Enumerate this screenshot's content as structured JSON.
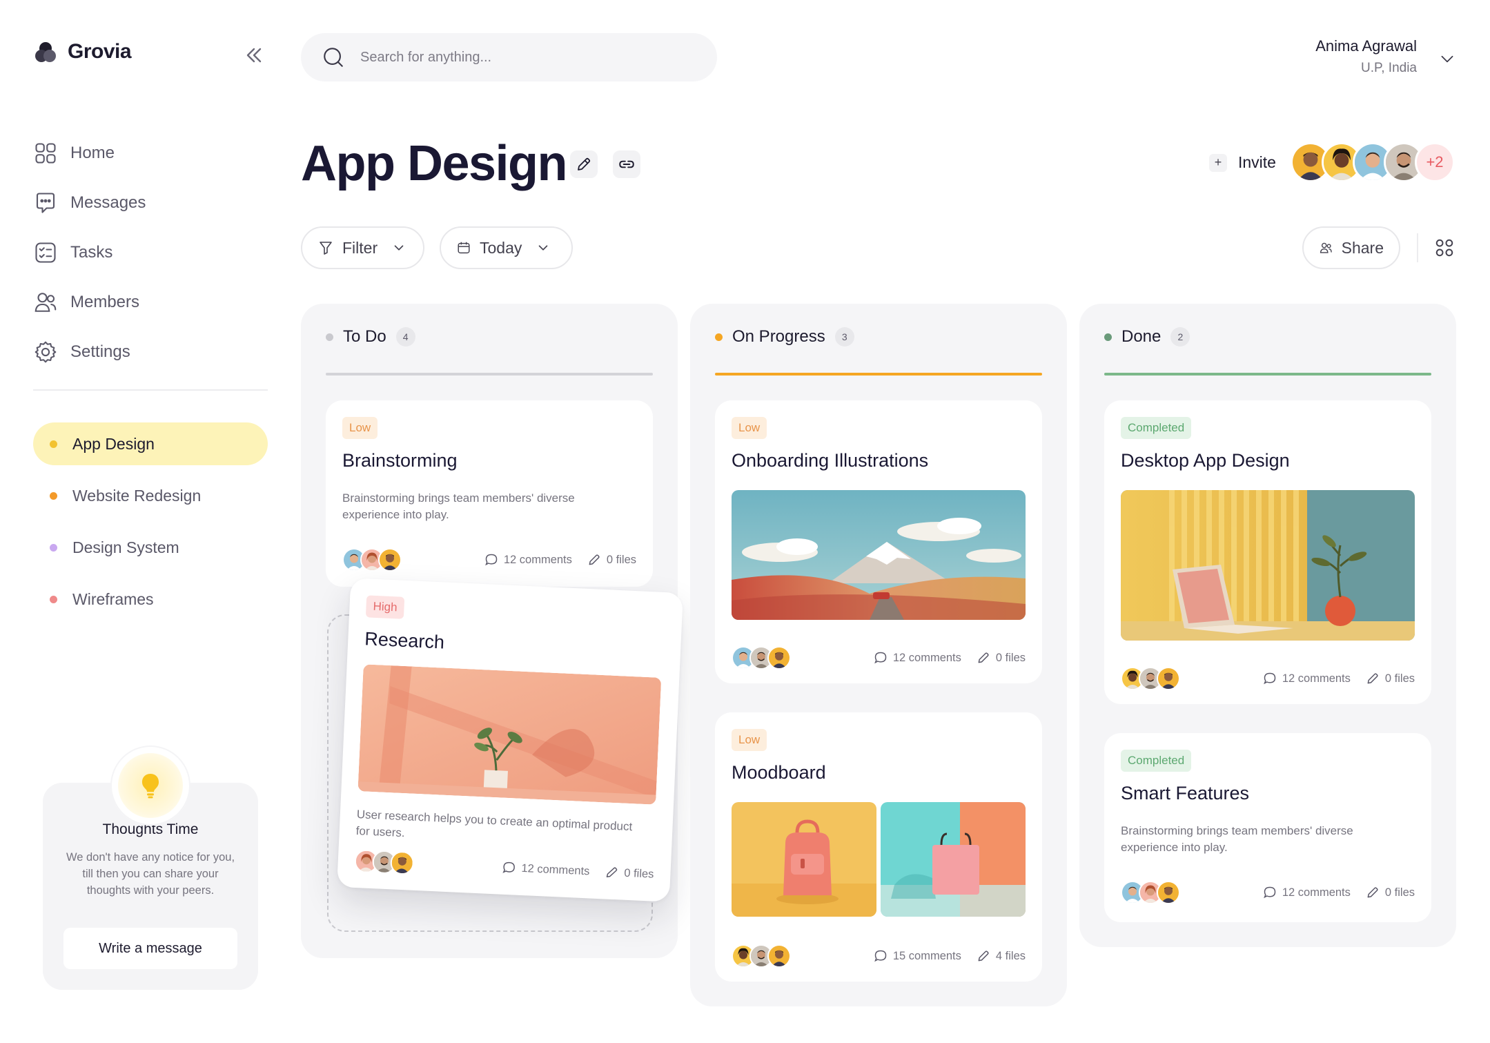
{
  "app": {
    "name": "Grovia"
  },
  "sidebar": {
    "nav": [
      {
        "label": "Home",
        "icon": "home-grid-icon"
      },
      {
        "label": "Messages",
        "icon": "message-icon"
      },
      {
        "label": "Tasks",
        "icon": "tasks-icon"
      },
      {
        "label": "Members",
        "icon": "members-icon"
      },
      {
        "label": "Settings",
        "icon": "gear-icon"
      }
    ],
    "projects": [
      {
        "label": "App Design",
        "color": "#f2c230",
        "active": true
      },
      {
        "label": "Website Redesign",
        "color": "#f39a2a",
        "active": false
      },
      {
        "label": "Design System",
        "color": "#c9a8f0",
        "active": false
      },
      {
        "label": "Wireframes",
        "color": "#ef8a8a",
        "active": false
      }
    ],
    "thoughts": {
      "title": "Thoughts Time",
      "text": "We don't have any notice for you, till then you can share your thoughts with your peers.",
      "button": "Write a message"
    }
  },
  "header": {
    "search_placeholder": "Search for anything...",
    "user_name": "Anima Agrawal",
    "user_location": "U.P, India"
  },
  "page": {
    "title": "App Design",
    "invite_label": "Invite",
    "extra_members": "+2",
    "filter_label": "Filter",
    "date_label": "Today",
    "share_label": "Share"
  },
  "columns": [
    {
      "name": "To Do",
      "count": "4",
      "color": "#d3d3d8"
    },
    {
      "name": "On Progress",
      "count": "3",
      "color": "#f5a623"
    },
    {
      "name": "Done",
      "count": "2",
      "color": "#7cb88a"
    }
  ],
  "cards": {
    "brainstorming": {
      "tag": "Low",
      "title": "Brainstorming",
      "desc": "Brainstorming brings team members' diverse experience into play.",
      "comments": "12 comments",
      "files": "0 files"
    },
    "research": {
      "tag": "High",
      "title": "Research",
      "desc": "User research helps you to create an optimal product for users.",
      "comments": "12 comments",
      "files": "0 files"
    },
    "onboarding": {
      "tag": "Low",
      "title": "Onboarding Illustrations",
      "comments": "12 comments",
      "files": "0 files"
    },
    "moodboard": {
      "tag": "Low",
      "title": "Moodboard",
      "comments": "15 comments",
      "files": "4 files"
    },
    "desktop": {
      "tag": "Completed",
      "title": "Desktop App Design",
      "comments": "12 comments",
      "files": "0 files"
    },
    "smart": {
      "tag": "Completed",
      "title": "Smart Features",
      "desc": "Brainstorming brings team members' diverse experience into play.",
      "comments": "12 comments",
      "files": "0 files"
    }
  }
}
